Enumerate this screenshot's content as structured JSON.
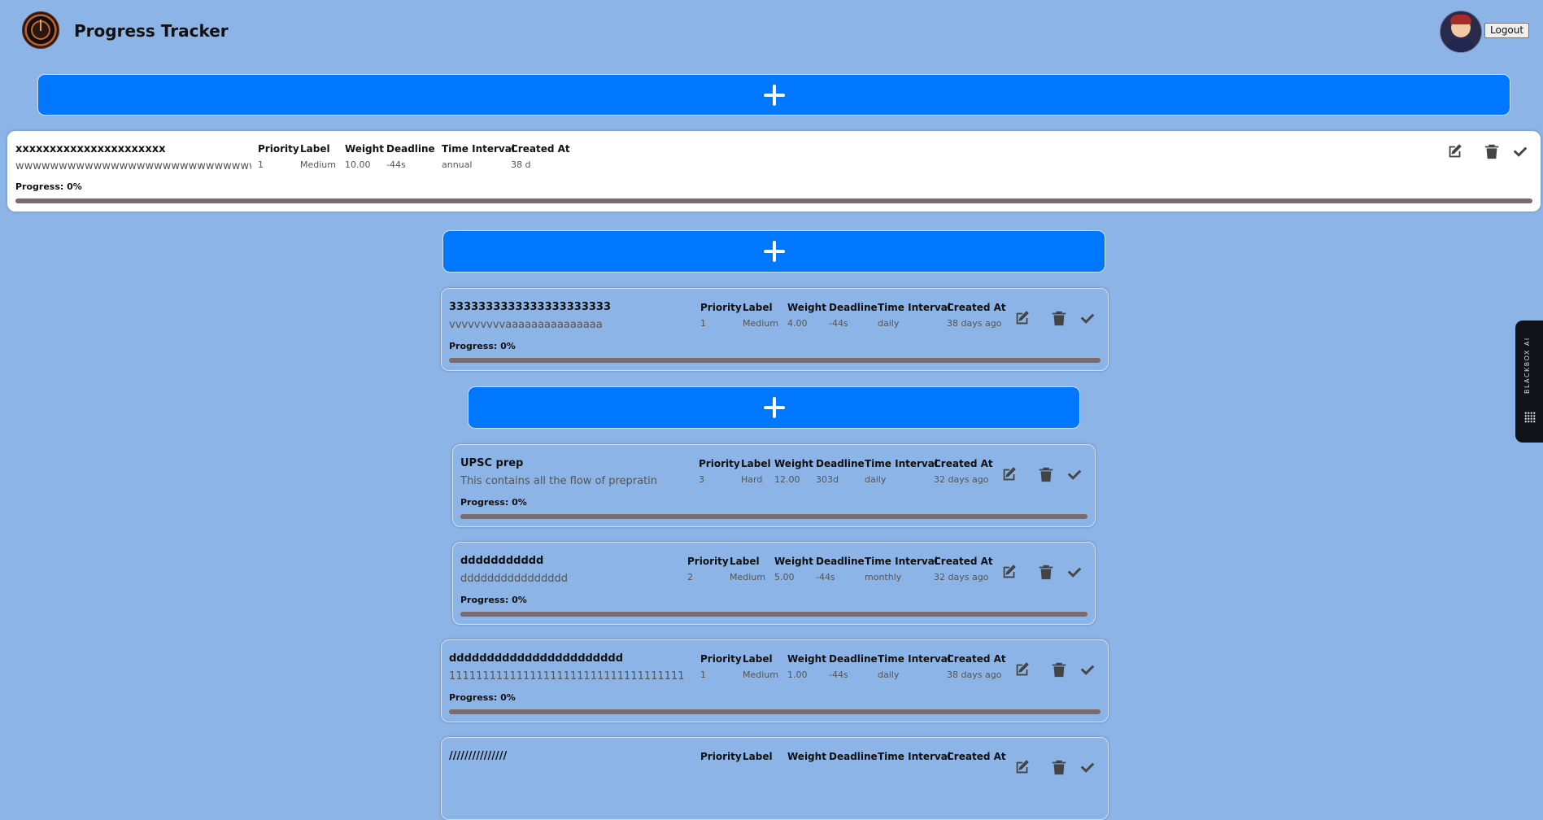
{
  "header": {
    "title": "Progress Tracker",
    "logout_label": "Logout"
  },
  "add_label": "+",
  "columns": [
    "Priority",
    "Label",
    "Weight",
    "Deadline",
    "Time Interval",
    "Created At"
  ],
  "progress_prefix": "Progress: ",
  "tasks": [
    {
      "title": "xxxxxxxxxxxxxxxxxxxxxx",
      "description": "wwwwwwwwwwwwwwwwwwwwwwwwwwwwwww",
      "priority": "1",
      "label": "Medium",
      "weight": "10.00",
      "deadline": "-44s",
      "interval": "annual",
      "created": "38 d",
      "progress": "Progress: 0%"
    },
    {
      "title": "3333333333333333333333",
      "description": "vvvvvvvvvaaaaaaaaaaaaaaa",
      "priority": "1",
      "label": "Medium",
      "weight": "4.00",
      "deadline": "-44s",
      "interval": "daily",
      "created": "38 days ago",
      "progress": "Progress: 0%"
    },
    {
      "title": "UPSC prep",
      "description": "This contains all the flow of prepratin",
      "priority": "3",
      "label": "Hard",
      "weight": "12.00",
      "deadline": "303d",
      "interval": "daily",
      "created": "32 days ago",
      "progress": "Progress: 0%"
    },
    {
      "title": "ddddddddddd",
      "description": "dddddddddddddddd",
      "priority": "2",
      "label": "Medium",
      "weight": "5.00",
      "deadline": "-44s",
      "interval": "monthly",
      "created": "32 days ago",
      "progress": "Progress: 0%"
    },
    {
      "title": "ddddddddddddddddddddddd",
      "description": "1111111111111111111111111111111111111",
      "priority": "1",
      "label": "Medium",
      "weight": "1.00",
      "deadline": "-44s",
      "interval": "daily",
      "created": "38 days ago",
      "progress": "Progress: 0%"
    },
    {
      "title": "///////////////"
    }
  ],
  "progress_value": 0,
  "side_widget": {
    "label": "BLACKBOX AI"
  },
  "colors": {
    "background": "#8cb4e6",
    "add_button": "#0077ff",
    "bar": "#7b6a6e",
    "card_active": "#ffffff"
  },
  "icons": {
    "edit": "edit-icon",
    "delete": "trash-icon",
    "complete": "check-icon"
  }
}
